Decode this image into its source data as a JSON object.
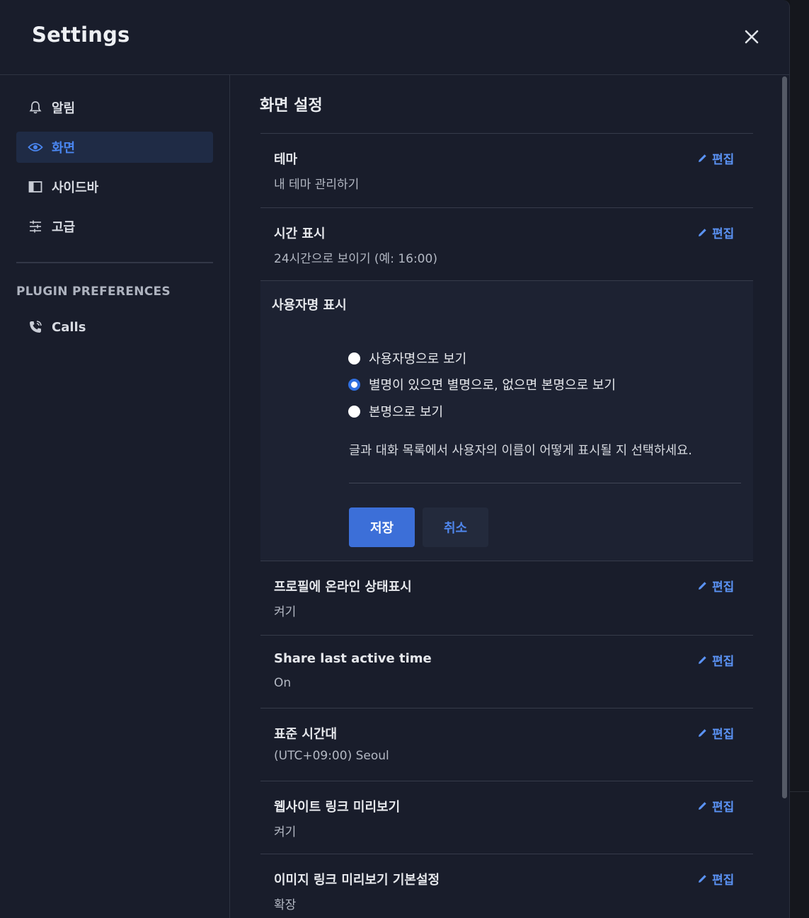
{
  "modal": {
    "title": "Settings"
  },
  "sidebar": {
    "items": [
      {
        "label": "알림",
        "icon": "bell-icon",
        "active": false
      },
      {
        "label": "화면",
        "icon": "eye-icon",
        "active": true
      },
      {
        "label": "사이드바",
        "icon": "sidebar-icon",
        "active": false
      },
      {
        "label": "고급",
        "icon": "sliders-icon",
        "active": false
      }
    ],
    "plugin_heading": "PLUGIN PREFERENCES",
    "plugins": [
      {
        "label": "Calls",
        "icon": "phone-icon"
      }
    ]
  },
  "main": {
    "section_title": "화면 설정",
    "edit_label": "편집",
    "settings": [
      {
        "title": "테마",
        "value": "내 테마 관리하기"
      },
      {
        "title": "시간 표시",
        "value": "24시간으로 보이기 (예: 16:00)"
      },
      {
        "title": "프로필에 온라인 상태표시",
        "value": "켜기"
      },
      {
        "title": "Share last active time",
        "value": "On"
      },
      {
        "title": "표준 시간대",
        "value": "(UTC+09:00) Seoul"
      },
      {
        "title": "웹사이트 링크 미리보기",
        "value": "켜기"
      },
      {
        "title": "이미지 링크 미리보기 기본설정",
        "value": "확장"
      }
    ],
    "expanded": {
      "title": "사용자명 표시",
      "options": [
        {
          "label": "사용자명으로 보기",
          "checked": false
        },
        {
          "label": "별명이 있으면 별명으로, 없으면 본명으로 보기",
          "checked": true
        },
        {
          "label": "본명으로 보기",
          "checked": false
        }
      ],
      "help": "글과 대화 목록에서 사용자의 이름이 어떻게 표시될 지 선택하세요.",
      "save_label": "저장",
      "cancel_label": "취소"
    }
  },
  "colors": {
    "accent": "#3c6fd8",
    "link": "#5b93f5",
    "panel": "#191d2b"
  }
}
